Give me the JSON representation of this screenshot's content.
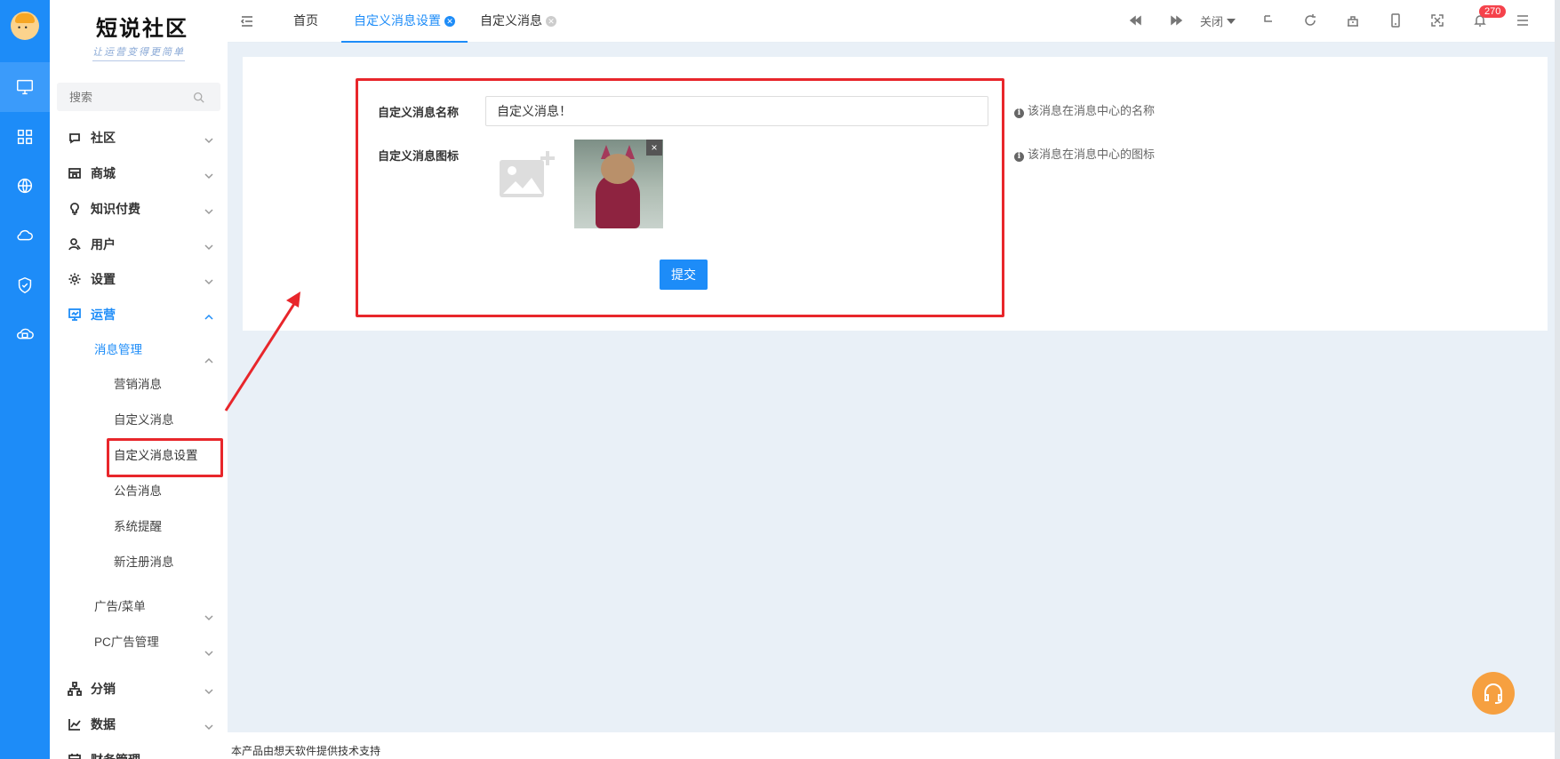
{
  "app": {
    "logo_title": "短说社区",
    "logo_subtitle": "让运营变得更简单"
  },
  "sidebar": {
    "search_placeholder": "搜索",
    "items": [
      {
        "label": "社区",
        "icon": "chat-icon"
      },
      {
        "label": "商城",
        "icon": "store-icon"
      },
      {
        "label": "知识付费",
        "icon": "bulb-icon"
      },
      {
        "label": "用户",
        "icon": "user-icon"
      },
      {
        "label": "设置",
        "icon": "gear-icon"
      },
      {
        "label": "运营",
        "icon": "presentation-icon"
      }
    ],
    "sub": {
      "message_mgmt": "消息管理",
      "marketing": "营销消息",
      "custom": "自定义消息",
      "custom_settings": "自定义消息设置",
      "announcement": "公告消息",
      "system": "系统提醒",
      "new_register": "新注册消息",
      "ads_menu": "广告/菜单",
      "pc_ads": "PC广告管理"
    },
    "bottom_items": [
      {
        "label": "分销",
        "icon": "network-icon"
      },
      {
        "label": "数据",
        "icon": "chart-icon"
      },
      {
        "label": "财务管理",
        "icon": "calendar-icon"
      }
    ]
  },
  "topbar": {
    "tabs": [
      {
        "label": "首页"
      },
      {
        "label": "自定义消息设置"
      },
      {
        "label": "自定义消息"
      }
    ],
    "close_label": "关闭",
    "notification_count": "270"
  },
  "form": {
    "name_label": "自定义消息名称",
    "name_value": "自定义消息！",
    "name_hint": "该消息在消息中心的名称",
    "icon_label": "自定义消息图标",
    "icon_hint": "该消息在消息中心的图标",
    "remove_label": "×",
    "submit_label": "提交"
  },
  "footer": {
    "text": "本产品由想天软件提供技术支持"
  },
  "colors": {
    "primary": "#1d8cf8",
    "highlight_red": "#e8262b",
    "badge": "#f5424b",
    "support": "#f6a040"
  }
}
